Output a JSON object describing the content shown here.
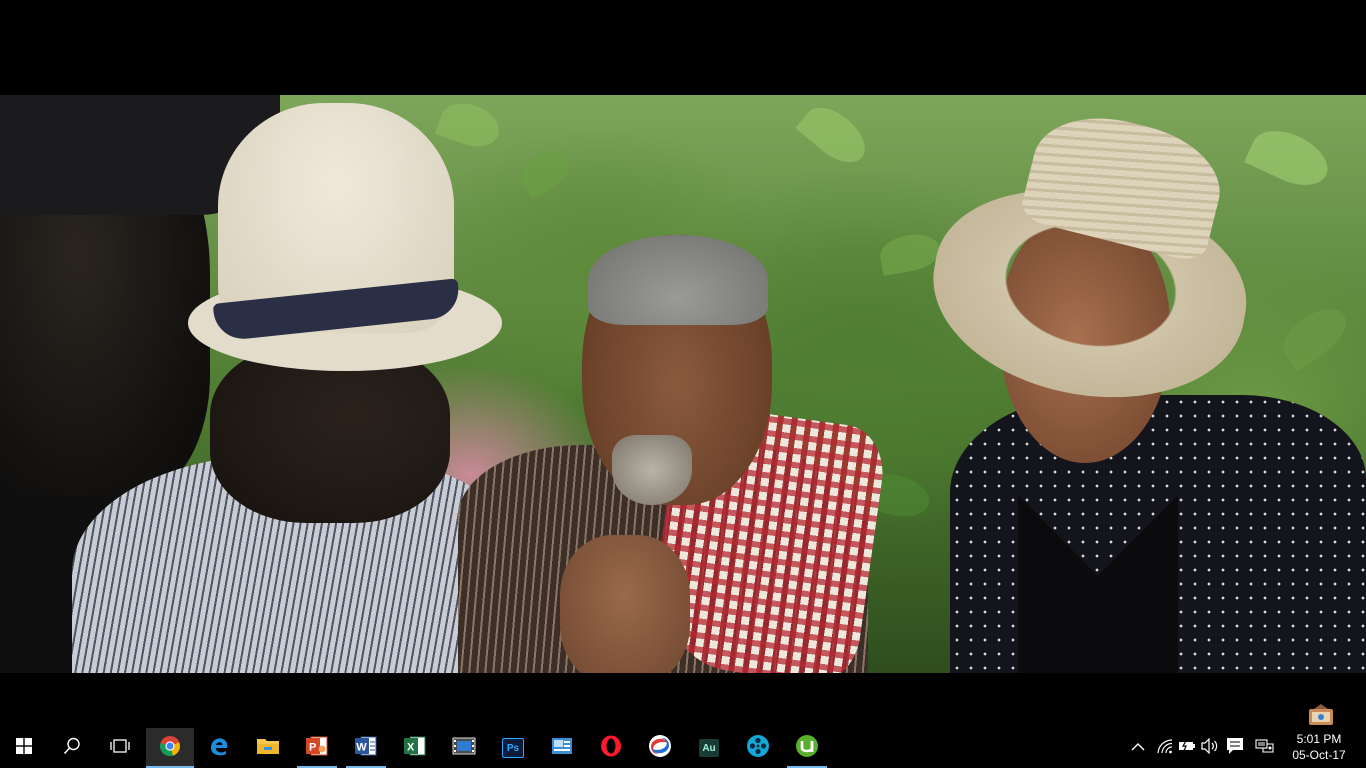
{
  "video": {
    "description_label": ""
  },
  "taskbar": {
    "apps": [
      {
        "id": "start",
        "icon": "windows-logo-icon"
      },
      {
        "id": "search",
        "icon": "search-icon"
      },
      {
        "id": "task-view",
        "icon": "task-view-icon"
      },
      {
        "id": "chrome",
        "icon": "chrome-icon",
        "state": "active"
      },
      {
        "id": "edge",
        "icon": "edge-icon"
      },
      {
        "id": "file-explorer",
        "icon": "folder-icon"
      },
      {
        "id": "powerpoint",
        "icon": "powerpoint-icon",
        "state": "running"
      },
      {
        "id": "word",
        "icon": "word-icon",
        "state": "running"
      },
      {
        "id": "excel",
        "icon": "excel-icon"
      },
      {
        "id": "movie-maker",
        "icon": "film-strip-icon"
      },
      {
        "id": "photoshop",
        "icon": "photoshop-icon",
        "label": "Ps"
      },
      {
        "id": "photo-app",
        "icon": "photo-viewer-icon"
      },
      {
        "id": "opera",
        "icon": "opera-icon"
      },
      {
        "id": "swirl-app",
        "icon": "swirl-browser-icon"
      },
      {
        "id": "audition",
        "icon": "audition-icon",
        "label": "Au"
      },
      {
        "id": "video-player",
        "icon": "film-reel-icon"
      },
      {
        "id": "utorrent",
        "icon": "utorrent-icon",
        "state": "running"
      }
    ],
    "colors": {
      "running_indicator": "#76b9ed",
      "active_background": "#2b2b2b"
    }
  },
  "tray": {
    "icons": [
      "chevron-up-icon",
      "wifi-icon",
      "battery-icon",
      "volume-icon",
      "notification-icon",
      "language-icon"
    ],
    "time": "5:01 PM",
    "date": "05-Oct-17"
  }
}
